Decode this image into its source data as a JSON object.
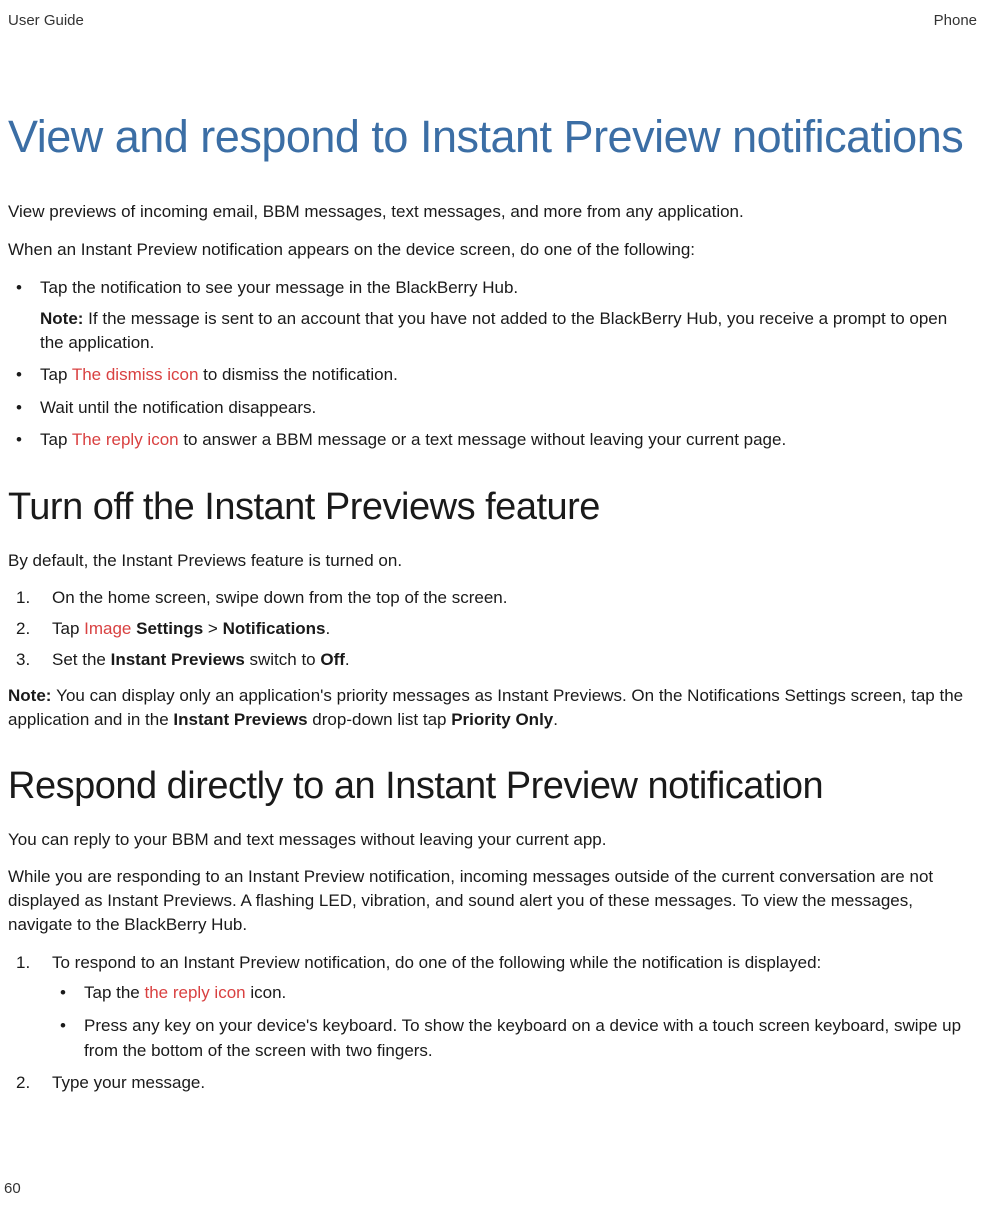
{
  "header": {
    "left": "User Guide",
    "right": "Phone"
  },
  "section1": {
    "title": "View and respond to Instant Preview notifications",
    "intro": "View previews of incoming email, BBM messages, text messages, and more from any application.",
    "lead": "When an Instant Preview notification appears on the device screen, do one of the following:",
    "items": {
      "i1_text": "Tap the notification to see your message in the BlackBerry Hub.",
      "i1_note_label": "Note: ",
      "i1_note": "If the message is sent to an account that you have not added to the BlackBerry Hub, you receive a prompt to open the application.",
      "i2_pre": "Tap ",
      "i2_icon": " The dismiss icon ",
      "i2_post": " to dismiss the notification.",
      "i3": "Wait until the notification disappears.",
      "i4_pre": "Tap ",
      "i4_icon": " The reply icon ",
      "i4_post": " to answer a BBM message or a text message without leaving your current page."
    }
  },
  "section2": {
    "title": "Turn off the Instant Previews feature",
    "intro": "By default, the Instant Previews feature is turned on.",
    "steps": {
      "s1": "On the home screen, swipe down from the top of the screen.",
      "s2_pre": "Tap ",
      "s2_icon": " Image ",
      "s2_mid": " ",
      "s2_bold1": "Settings",
      "s2_gt": " > ",
      "s2_bold2": "Notifications",
      "s2_end": ".",
      "s3_pre": "Set the ",
      "s3_bold1": "Instant Previews",
      "s3_mid": " switch to ",
      "s3_bold2": "Off",
      "s3_end": "."
    },
    "note_label": "Note: ",
    "note_pre": "You can display only an application's priority messages as Instant Previews. On the Notifications Settings screen, tap the application and in the ",
    "note_bold1": "Instant Previews",
    "note_mid": " drop-down list tap ",
    "note_bold2": "Priority Only",
    "note_end": "."
  },
  "section3": {
    "title": "Respond directly to an Instant Preview notification",
    "p1": "You can reply to your BBM and text messages without leaving your current app.",
    "p2": "While you are responding to an Instant Preview notification, incoming messages outside of the current conversation are not displayed as Instant Previews. A flashing LED, vibration, and sound alert you of these messages. To view the messages, navigate to the BlackBerry Hub.",
    "steps": {
      "s1": "To respond to an Instant Preview notification, do one of the following while the notification is displayed:",
      "s1_sub": {
        "a_pre": "Tap the ",
        "a_icon": " the reply icon ",
        "a_post": " icon.",
        "b": "Press any key on your device's keyboard. To show the keyboard on a device with a touch screen keyboard, swipe up from the bottom of the screen with two fingers."
      },
      "s2": "Type your message."
    }
  },
  "page_number": "60"
}
